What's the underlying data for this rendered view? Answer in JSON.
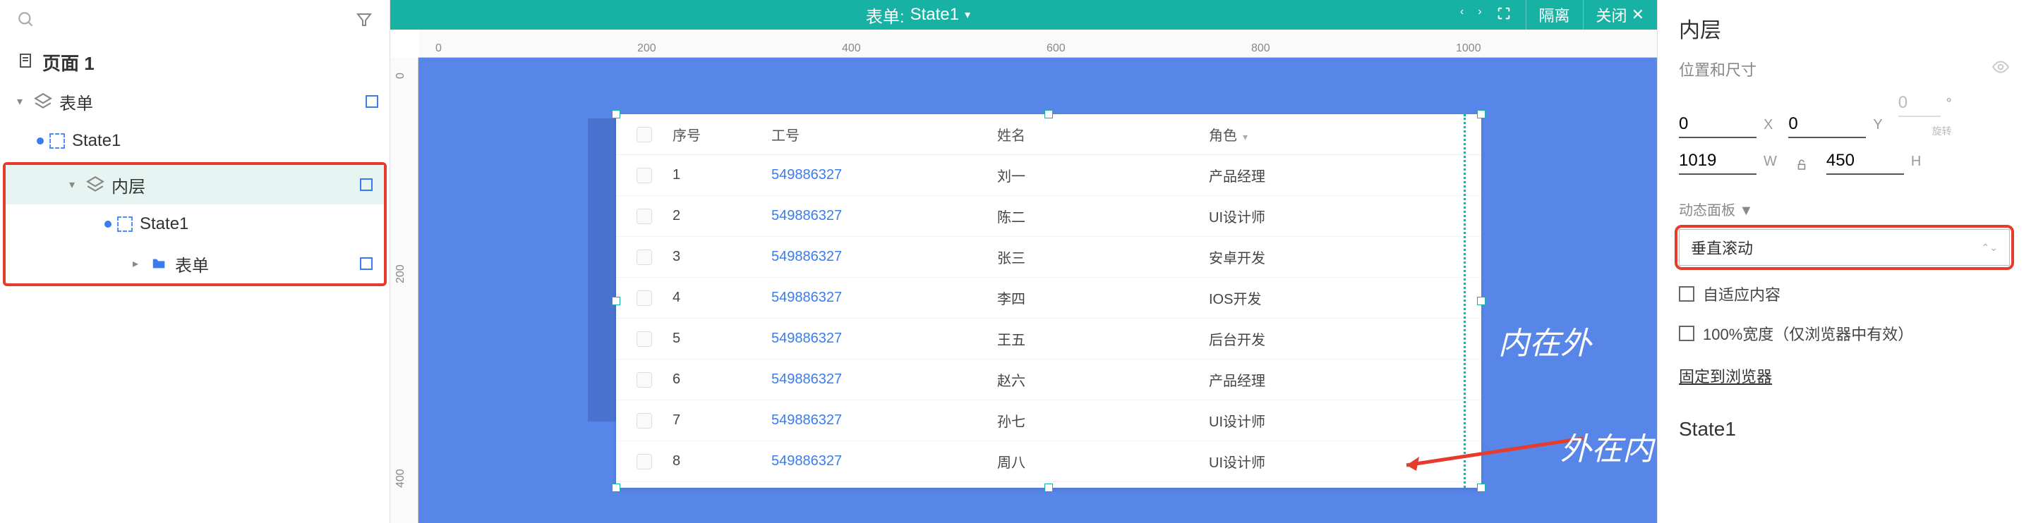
{
  "sidebar": {
    "page_label": "页面 1",
    "items": [
      {
        "label": "表单",
        "type": "layers"
      },
      {
        "label": "State1",
        "type": "dashed",
        "indent": 1
      },
      {
        "label": "内层",
        "type": "layers",
        "indent": 2,
        "selected": true,
        "markred": true
      },
      {
        "label": "State1",
        "type": "dashed",
        "indent": 3,
        "markred": true
      },
      {
        "label": "表单",
        "type": "folder",
        "indent": 4,
        "markred": true
      }
    ]
  },
  "toolbar": {
    "title_prefix": "表单:",
    "title_name": "State1",
    "isolate": "隔离",
    "close": "关闭"
  },
  "ruler_h": [
    "0",
    "200",
    "400",
    "600",
    "800",
    "1000"
  ],
  "ruler_v": [
    "0",
    "200",
    "400"
  ],
  "table": {
    "headers": {
      "idx": "序号",
      "wid": "工号",
      "name": "姓名",
      "role": "角色"
    },
    "rows": [
      {
        "idx": "1",
        "wid": "549886327",
        "name": "刘一",
        "role": "产品经理"
      },
      {
        "idx": "2",
        "wid": "549886327",
        "name": "陈二",
        "role": "UI设计师"
      },
      {
        "idx": "3",
        "wid": "549886327",
        "name": "张三",
        "role": "安卓开发"
      },
      {
        "idx": "4",
        "wid": "549886327",
        "name": "李四",
        "role": "IOS开发"
      },
      {
        "idx": "5",
        "wid": "549886327",
        "name": "王五",
        "role": "后台开发"
      },
      {
        "idx": "6",
        "wid": "549886327",
        "name": "赵六",
        "role": "产品经理"
      },
      {
        "idx": "7",
        "wid": "549886327",
        "name": "孙七",
        "role": "UI设计师"
      },
      {
        "idx": "8",
        "wid": "549886327",
        "name": "周八",
        "role": "UI设计师"
      }
    ]
  },
  "annotations": {
    "t1": "内在外",
    "t2": "外在内"
  },
  "inspector": {
    "title": "内层",
    "pos_label": "位置和尺寸",
    "x": "0",
    "y": "0",
    "rot": "0",
    "rot_label": "旋转",
    "w": "1019",
    "h": "450",
    "units": {
      "x": "X",
      "y": "Y",
      "deg": "°",
      "w": "W",
      "h": "H"
    },
    "dp_label": "动态面板 ▼",
    "scroll": "垂直滚动",
    "fit": "自适应内容",
    "fullw": "100%宽度（仅浏览器中有效）",
    "pin": "固定到浏览器",
    "state": "State1"
  }
}
